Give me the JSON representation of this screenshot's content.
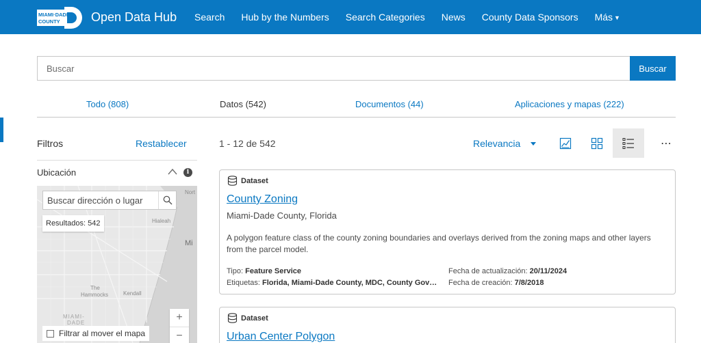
{
  "header": {
    "logo_line1": "MIAMI·DADE",
    "logo_line2": "COUNTY",
    "title": "Open Data Hub",
    "nav": [
      "Search",
      "Hub by the Numbers",
      "Search Categories",
      "News",
      "County Data Sponsors"
    ],
    "more": "Más",
    "color": "#0a78c2"
  },
  "search": {
    "placeholder": "Buscar",
    "button": "Buscar"
  },
  "tabs": [
    "Todo (808)",
    "Datos (542)",
    "Documentos (44)",
    "Aplicaciones y mapas (222)"
  ],
  "active_tab": 1,
  "filters": {
    "title": "Filtros",
    "reset": "Restablecer",
    "location_title": "Ubicación",
    "info_icon": "info-icon",
    "chevron_icon": "chevron-up-icon",
    "map": {
      "search_placeholder": "Buscar dirección o lugar",
      "results": "Resultados: 542",
      "labels": [
        "Nort",
        "Hialeah",
        "Mi",
        "The",
        "Hammocks",
        "Kendall",
        "MIAMI-",
        "DADE"
      ],
      "zoom_in": "+",
      "zoom_out": "−",
      "filter_on_move": "Filtrar al mover el mapa"
    }
  },
  "results": {
    "count": "1 - 12 de 542",
    "sort": "Relevancia",
    "more_icon": "⋯",
    "view_icons": [
      "chart-view-icon",
      "grid-view-icon",
      "list-view-icon"
    ],
    "active_view": 2
  },
  "cards": [
    {
      "type": "Dataset",
      "title": "County Zoning",
      "owner": "Miami-Dade County, Florida",
      "description": "A polygon feature class of the county zoning boundaries and overlays derived from the zoning maps and other layers from the parcel model.",
      "type_label": "Tipo:",
      "type_value": "Feature Service",
      "tags_label": "Etiquetas:",
      "tags_value": "Florida, Miami-Dade County, MDC, County Gov…",
      "updated_label": "Fecha de actualización:",
      "updated_value": "20/11/2024",
      "created_label": "Fecha de creación:",
      "created_value": "7/8/2018"
    },
    {
      "type": "Dataset",
      "title": "Urban Center Polygon"
    }
  ]
}
